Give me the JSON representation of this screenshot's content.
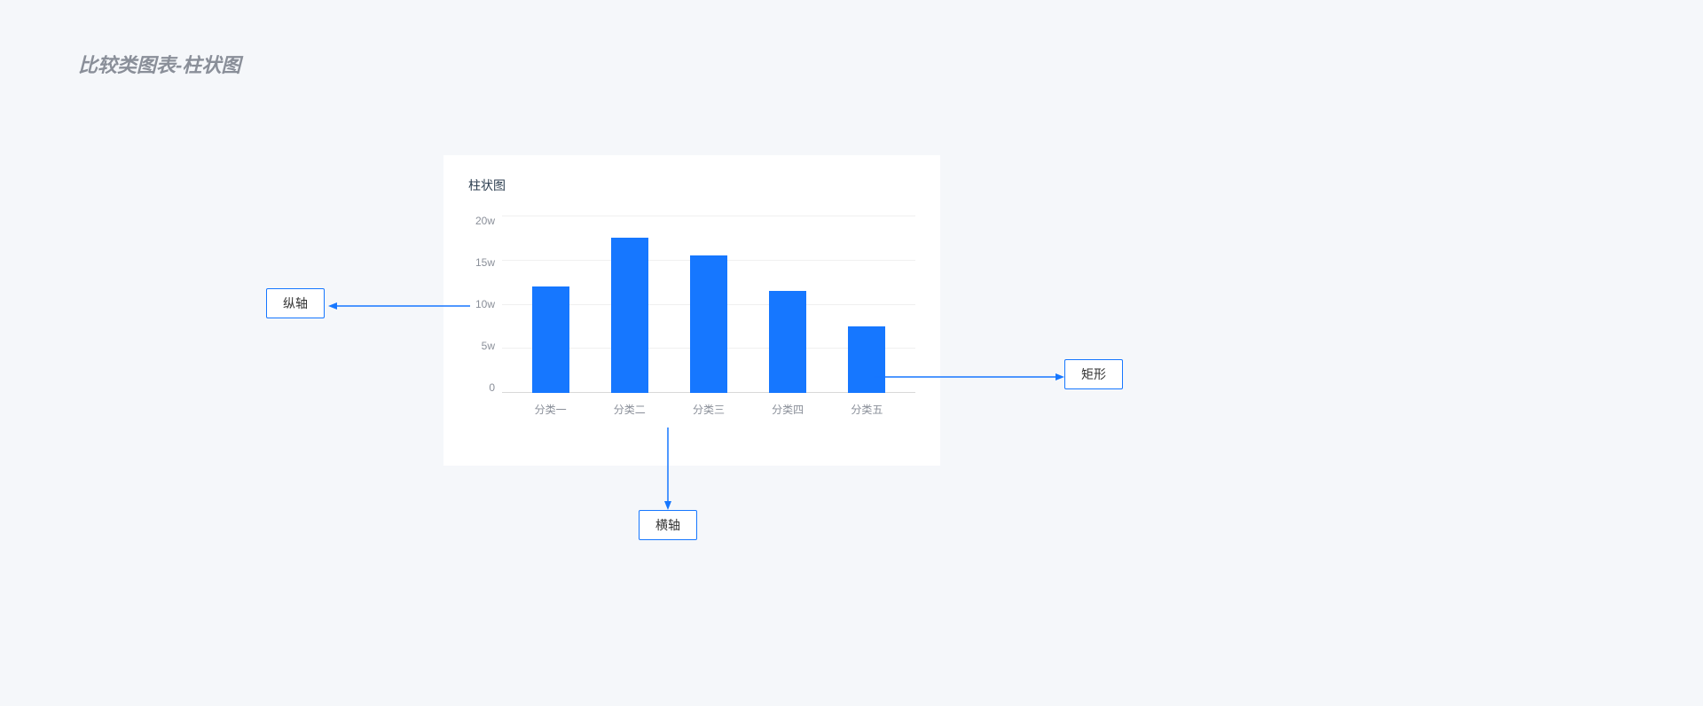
{
  "page_title": "比较类图表-柱状图",
  "card_title": "柱状图",
  "annotations": {
    "y_axis": "纵轴",
    "x_axis": "横轴",
    "bar": "矩形"
  },
  "chart_data": {
    "type": "bar",
    "title": "柱状图",
    "xlabel": "",
    "ylabel": "",
    "categories": [
      "分类一",
      "分类二",
      "分类三",
      "分类四",
      "分类五"
    ],
    "values": [
      12,
      17.5,
      15.5,
      11.5,
      7.5
    ],
    "y_ticks": [
      "20w",
      "15w",
      "10w",
      "5w",
      "0"
    ],
    "ylim": [
      0,
      20
    ],
    "unit": "w",
    "bar_color": "#1677ff"
  }
}
